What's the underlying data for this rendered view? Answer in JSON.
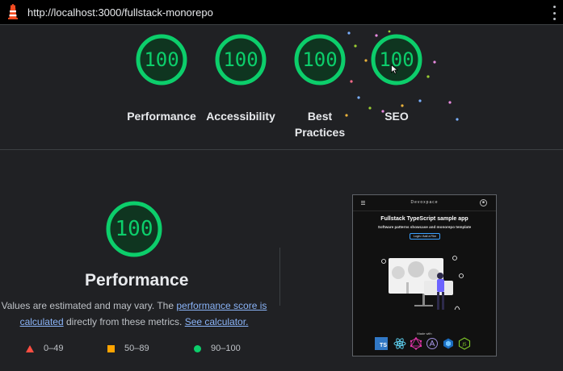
{
  "browser": {
    "url": "http://localhost:3000/fullstack-monorepo",
    "menu_icon": "kebab-menu-icon",
    "logo_icon": "lighthouse-icon"
  },
  "colors": {
    "pass": "#0cce6b",
    "average": "#ffa400",
    "fail": "#ff4e42",
    "link": "#8ab4f8",
    "background": "#202124"
  },
  "summary": {
    "gauges": [
      {
        "score": "100",
        "label": "Performance"
      },
      {
        "score": "100",
        "label": "Accessibility"
      },
      {
        "score": "100",
        "label": "Best Practices"
      },
      {
        "score": "100",
        "label": "SEO"
      }
    ]
  },
  "performance": {
    "score": "100",
    "title": "Performance",
    "desc_prefix": "Values are estimated and may vary. The ",
    "desc_link1": "performance score is calculated",
    "desc_mid": " directly from these metrics. ",
    "desc_link2": "See calculator."
  },
  "legend": [
    {
      "marker": "triangle",
      "range": "0–49"
    },
    {
      "marker": "square",
      "range": "50–89"
    },
    {
      "marker": "circle",
      "range": "90–100"
    }
  ],
  "screenshot": {
    "brand": "Devoxpace",
    "title": "Fullstack TypeScript sample app",
    "subtitle": "Software patterns showcase and monorepo template",
    "button": "Login / Add a Film",
    "made_with": "Made with",
    "ts_badge": "TS",
    "tech_icons": [
      "typescript-icon",
      "react-icon",
      "graphql-icon",
      "apollo-icon",
      "nx-icon",
      "nodejs-icon"
    ]
  }
}
